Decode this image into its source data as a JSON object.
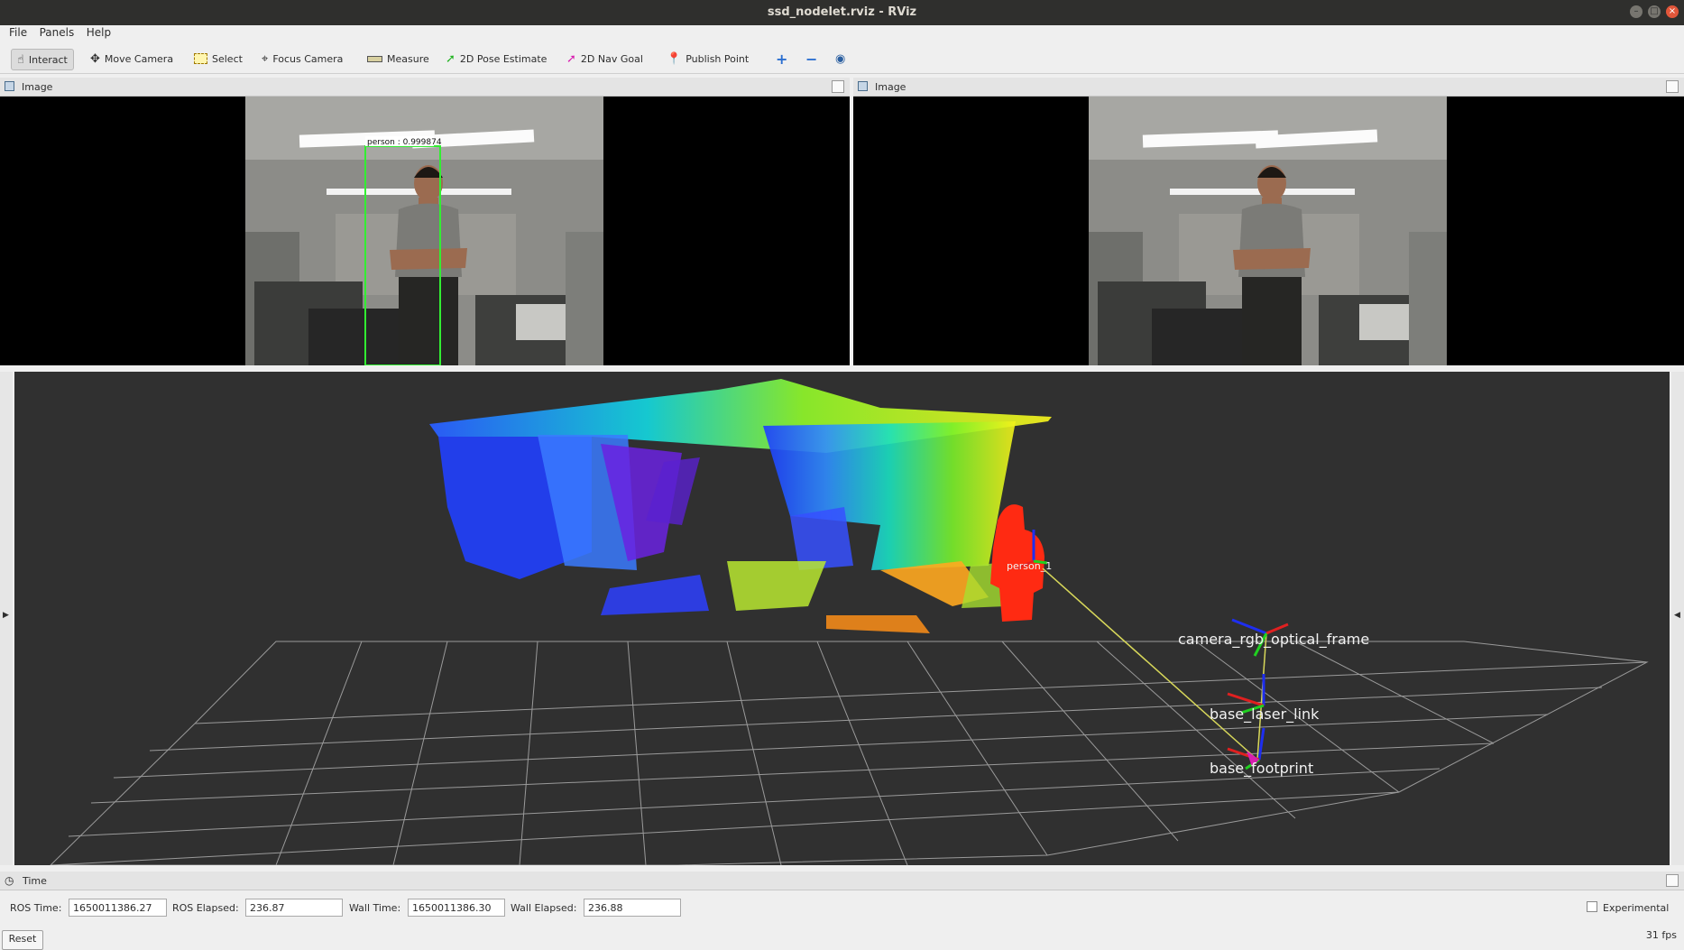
{
  "window": {
    "title": "ssd_nodelet.rviz - RViz",
    "controls": [
      "–",
      "□",
      "×"
    ]
  },
  "menu": {
    "file": "File",
    "panels": "Panels",
    "help": "Help"
  },
  "toolbar": {
    "interact": "Interact",
    "move_camera": "Move Camera",
    "select": "Select",
    "focus_camera": "Focus Camera",
    "measure": "Measure",
    "pose_estimate": "2D Pose Estimate",
    "nav_goal": "2D Nav Goal",
    "publish_point": "Publish Point"
  },
  "image_panels": [
    {
      "title": "Image",
      "detection_label": "person : 0.999874"
    },
    {
      "title": "Image"
    }
  ],
  "viewport": {
    "person_label": "person_1",
    "frames": {
      "camera_optical": "camera_rgb_optical_frame",
      "laser_link": "base_laser_link",
      "footprint": "base_footprint"
    }
  },
  "time_panel": {
    "title": "Time",
    "ros_time_label": "ROS Time:",
    "ros_time": "1650011386.27",
    "ros_elapsed_label": "ROS Elapsed:",
    "ros_elapsed": "236.87",
    "wall_time_label": "Wall Time:",
    "wall_time": "1650011386.30",
    "wall_elapsed_label": "Wall Elapsed:",
    "wall_elapsed": "236.88",
    "experimental_label": "Experimental"
  },
  "footer": {
    "reset": "Reset",
    "fps": "31 fps"
  }
}
